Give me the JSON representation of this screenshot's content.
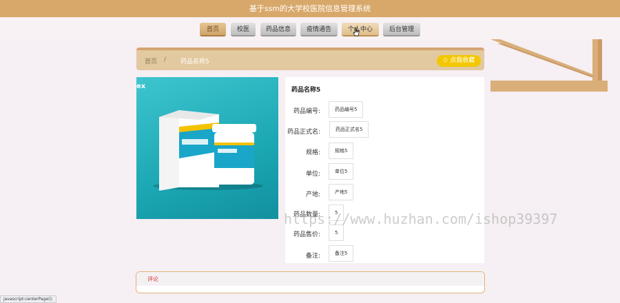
{
  "header": {
    "title": "基于ssm的大学校医院信息管理系统"
  },
  "nav": {
    "items": [
      {
        "label": "首页"
      },
      {
        "label": "校医"
      },
      {
        "label": "药品信息"
      },
      {
        "label": "疫情通告"
      },
      {
        "label": "个人中心"
      },
      {
        "label": "后台管理"
      }
    ]
  },
  "breadcrumb": {
    "home": "首页",
    "separator": "/",
    "current": "药品名称5"
  },
  "favorite": {
    "label": "✩ 点我收藏"
  },
  "product": {
    "title": "药品名称5",
    "fields": [
      {
        "label": "药品编号:",
        "value": "药品编号5"
      },
      {
        "label": "药品正式名:",
        "value": "药品正式名5"
      },
      {
        "label": "规格:",
        "value": "规格5"
      },
      {
        "label": "单位:",
        "value": "单位5"
      },
      {
        "label": "产地:",
        "value": "产地5"
      },
      {
        "label": "药品数量:",
        "value": "5"
      },
      {
        "label": "药品售价:",
        "value": "5"
      },
      {
        "label": "备注:",
        "value": "备注5"
      }
    ]
  },
  "image": {
    "logo": "ex"
  },
  "comments": {
    "label": "评论"
  },
  "status": {
    "text": "javascript:centerPage();"
  },
  "watermark": {
    "text": "https://www.huzhan.com/ishop39397"
  },
  "colors": {
    "header": "#d8a86a",
    "accent": "#f3c800",
    "comment_border": "#e3b27a"
  }
}
